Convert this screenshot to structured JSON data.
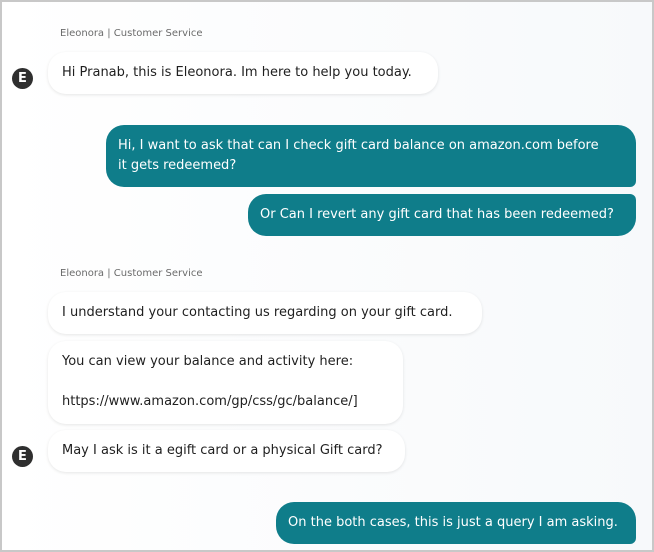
{
  "agent": {
    "label": "Eleonora | Customer Service",
    "avatar_letter": "E"
  },
  "messages": {
    "m1": "Hi Pranab, this is Eleonora. Im here to help you today.",
    "m2_line1": "Hi, I want to ask that can I check gift card balance on amazon.com before",
    "m2_line2": "it gets redeemed?",
    "m3": "Or Can I revert any gift card that has been redeemed?",
    "m4": "I understand your contacting us regarding on your gift card.",
    "m5_line1": "You can view your balance and activity here:",
    "m5_line2": "https://www.amazon.com/gp/css/gc/balance/]",
    "m6": "May I ask is it a egift card or a physical Gift card?",
    "m7": "On the both cases, this is just a query I am asking."
  },
  "colors": {
    "customer_bubble": "#0f7d8a",
    "agent_bubble": "#ffffff",
    "avatar": "#2f2f2f"
  }
}
